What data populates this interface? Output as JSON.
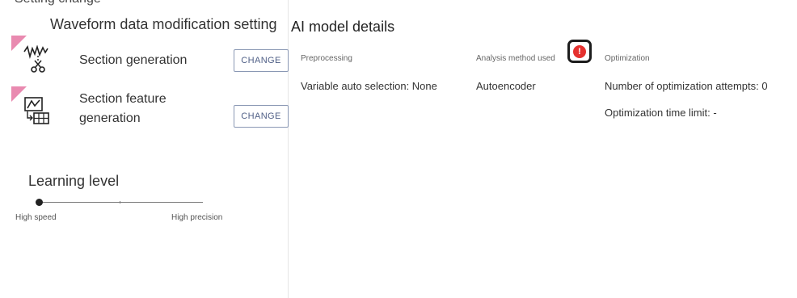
{
  "clipped_header": "Setting change",
  "waveform": {
    "title": "Waveform data modification setting",
    "rows": [
      {
        "label": "Section generation",
        "button": "CHANGE",
        "icon": "waveform-scissors-icon"
      },
      {
        "label": "Section feature generation",
        "button": "CHANGE",
        "icon": "chart-table-icon"
      }
    ]
  },
  "learning": {
    "title": "Learning level",
    "left_label": "High speed",
    "right_label": "High precision",
    "level": 0
  },
  "details": {
    "title": "AI model details",
    "columns": [
      {
        "header": "Preprocessing",
        "values": [
          "Variable auto selection: None"
        ]
      },
      {
        "header": "Analysis method used",
        "values": [
          "Autoencoder"
        ]
      },
      {
        "header": "Optimization",
        "values": [
          "Number of optimization attempts: 0",
          "Optimization time limit: -"
        ]
      }
    ],
    "warning_icon": "!"
  },
  "colors": {
    "flag": "#e98ab0",
    "button_border": "#8a98b4",
    "warning": "#e5312f"
  }
}
